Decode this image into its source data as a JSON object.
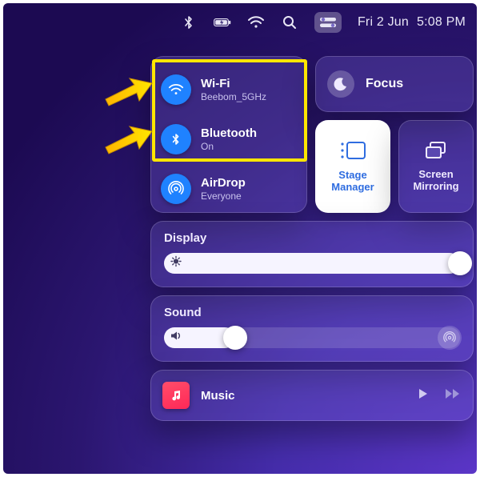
{
  "menubar": {
    "date": "Fri 2 Jun",
    "time": "5:08 PM"
  },
  "conn": {
    "wifi": {
      "title": "Wi-Fi",
      "subtitle": "Beebom_5GHz"
    },
    "bluetooth": {
      "title": "Bluetooth",
      "subtitle": "On"
    },
    "airdrop": {
      "title": "AirDrop",
      "subtitle": "Everyone"
    }
  },
  "focus": {
    "label": "Focus"
  },
  "tiles": {
    "stage": "Stage\nManager",
    "mirror": "Screen\nMirroring"
  },
  "display": {
    "title": "Display",
    "value": 100
  },
  "sound": {
    "title": "Sound",
    "value": 24
  },
  "music": {
    "name": "Music"
  }
}
